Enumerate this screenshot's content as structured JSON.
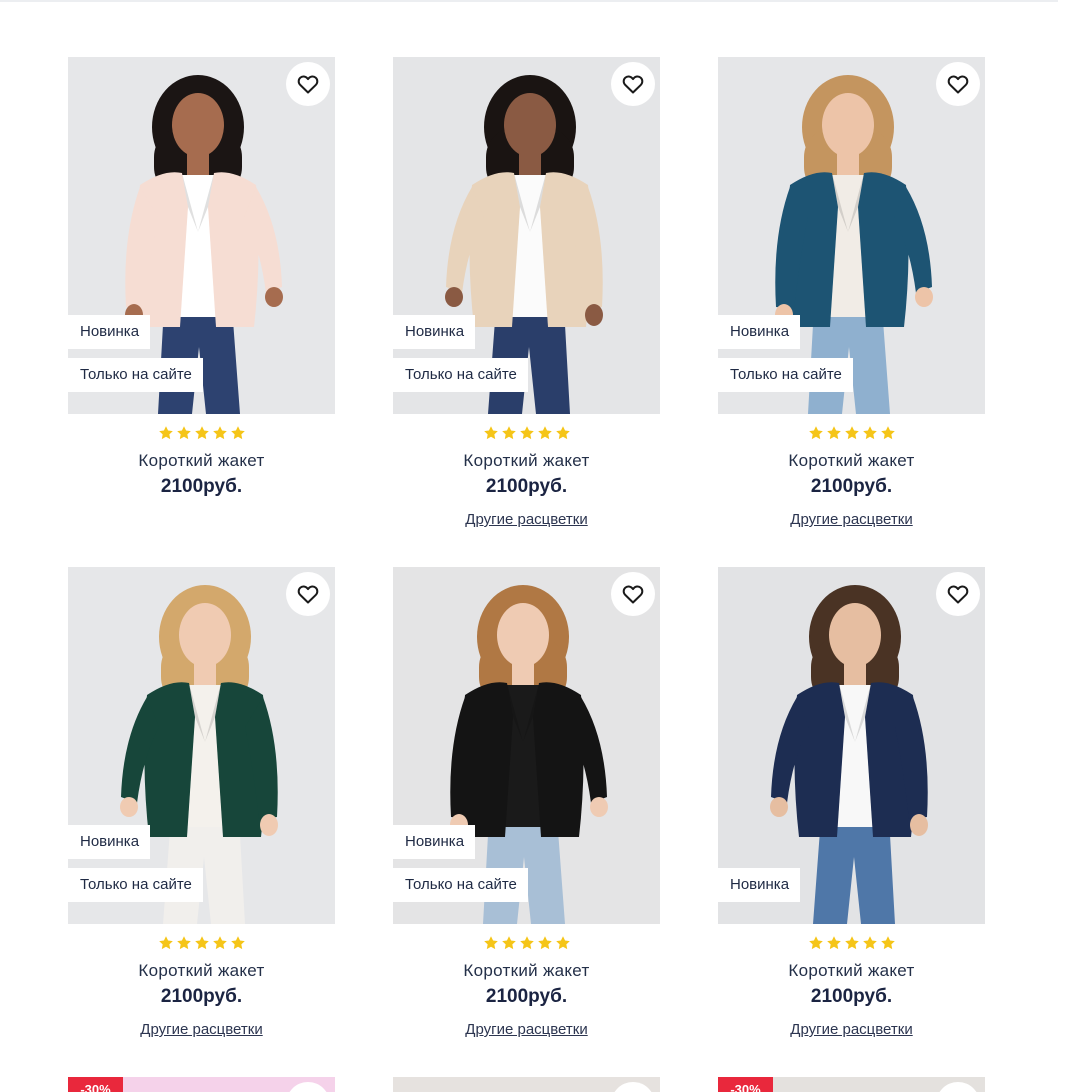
{
  "products": [
    {
      "badges": [
        "Новинка",
        "Только на сайте"
      ],
      "rating": 5,
      "name": "Короткий жакет",
      "price": "2100руб.",
      "other_colors": "",
      "photo": {
        "bg": "#e6e7e9",
        "jacket": "#f6ddd3",
        "hair": "#1b1514",
        "skin": "#a66c4f",
        "top": "#ffffff",
        "bottom": "#2d4270"
      }
    },
    {
      "badges": [
        "Новинка",
        "Только на сайте"
      ],
      "rating": 5,
      "name": "Короткий жакет",
      "price": "2100руб.",
      "other_colors": "Другие расцветки",
      "photo": {
        "bg": "#e4e5e7",
        "jacket": "#e8d3bb",
        "hair": "#1a1412",
        "skin": "#8a5a43",
        "top": "#fbfbfb",
        "bottom": "#2a3e6a"
      }
    },
    {
      "badges": [
        "Новинка",
        "Только на сайте"
      ],
      "rating": 5,
      "name": "Короткий жакет",
      "price": "2100руб.",
      "other_colors": "Другие расцветки",
      "photo": {
        "bg": "#e5e6e8",
        "jacket": "#1d5473",
        "hair": "#c4955f",
        "skin": "#edc4a8",
        "top": "#f1ece6",
        "bottom": "#8fb0cf"
      }
    },
    {
      "badges": [
        "Новинка",
        "Только на сайте"
      ],
      "rating": 5,
      "name": "Короткий жакет",
      "price": "2100руб.",
      "other_colors": "Другие расцветки",
      "photo": {
        "bg": "#e6e7e9",
        "jacket": "#17463a",
        "hair": "#d3a86c",
        "skin": "#f0cbb2",
        "top": "#f4f1ec",
        "bottom": "#f1efec"
      }
    },
    {
      "badges": [
        "Новинка",
        "Только на сайте"
      ],
      "rating": 5,
      "name": "Короткий жакет",
      "price": "2100руб.",
      "other_colors": "Другие расцветки",
      "photo": {
        "bg": "#e4e4e5",
        "jacket": "#141414",
        "hair": "#b07844",
        "skin": "#efcbb3",
        "top": "#1a1a1a",
        "bottom": "#a8bfd6"
      }
    },
    {
      "badges": [
        "Новинка"
      ],
      "rating": 5,
      "name": "Короткий жакет",
      "price": "2100руб.",
      "other_colors": "Другие расцветки",
      "photo": {
        "bg": "#e2e3e5",
        "jacket": "#1d2d52",
        "hair": "#4a3324",
        "skin": "#e6bea1",
        "top": "#f8f8f8",
        "bottom": "#4f77a8"
      }
    }
  ],
  "partial_row": [
    {
      "sale": "-30%",
      "bg": "#f5d2ea"
    },
    {
      "sale": "",
      "bg": "#e6e2df"
    },
    {
      "sale": "-30%",
      "bg": "#e4e1de"
    }
  ],
  "colors": {
    "star": "#f5c518",
    "sale": "#e9283c",
    "text": "#1f2a44"
  }
}
